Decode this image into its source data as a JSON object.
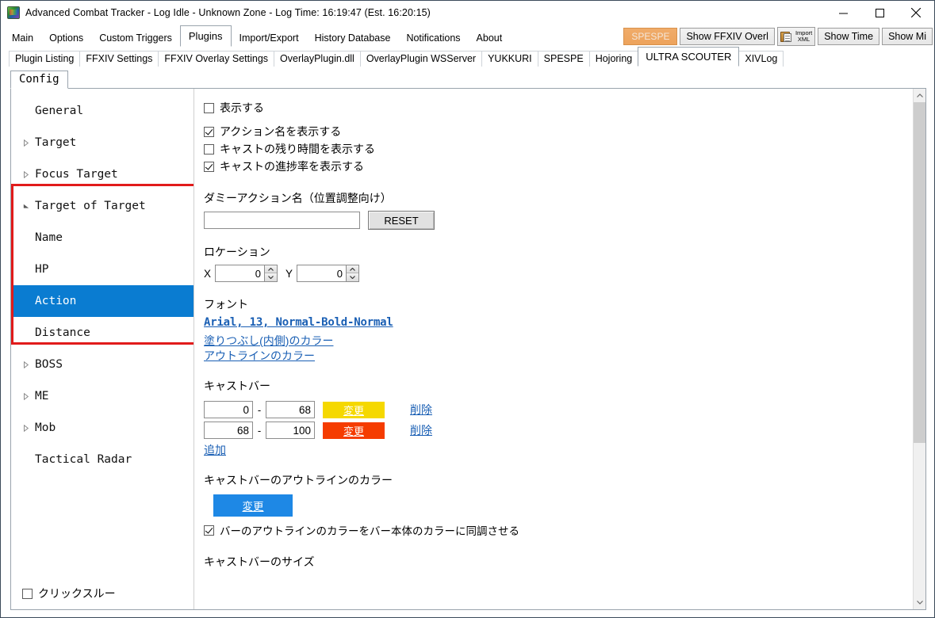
{
  "window": {
    "title": "Advanced Combat Tracker - Log Idle - Unknown Zone - Log Time: 16:19:47 (Est. 16:20:15)",
    "app_icon": "act-app-icon",
    "minimize": "minimize-icon",
    "maximize": "maximize-icon",
    "close": "close-icon"
  },
  "main_tabs": [
    {
      "label": "Main",
      "active": false
    },
    {
      "label": "Options",
      "active": false
    },
    {
      "label": "Custom Triggers",
      "active": false
    },
    {
      "label": "Plugins",
      "active": true
    },
    {
      "label": "Import/Export",
      "active": false
    },
    {
      "label": "History Database",
      "active": false
    },
    {
      "label": "Notifications",
      "active": false
    },
    {
      "label": "About",
      "active": false
    }
  ],
  "toolbar": {
    "spespe_label": "SPESPE",
    "spespe_color": "#eda35c",
    "show_overlay_label": "Show FFXIV Overl",
    "import_xml_line1": "Import",
    "import_xml_line2": "XML",
    "show_time_label": "Show Time",
    "show_mi_label": "Show Mi"
  },
  "plugin_tabs": [
    {
      "label": "Plugin Listing",
      "active": false
    },
    {
      "label": "FFXIV Settings",
      "active": false
    },
    {
      "label": "FFXIV Overlay Settings",
      "active": false
    },
    {
      "label": "OverlayPlugin.dll",
      "active": false
    },
    {
      "label": "OverlayPlugin WSServer",
      "active": false
    },
    {
      "label": "YUKKURI",
      "active": false
    },
    {
      "label": "SPESPE",
      "active": false
    },
    {
      "label": "Hojoring",
      "active": false
    },
    {
      "label": "ULTRA SCOUTER",
      "active": true
    },
    {
      "label": "XIVLog",
      "active": false
    }
  ],
  "config_tab": {
    "label": "Config"
  },
  "tree": {
    "items": [
      {
        "label": "General",
        "depth": 0,
        "expander": "none",
        "selected": false
      },
      {
        "label": "Target",
        "depth": 0,
        "expander": "collapsed",
        "selected": false
      },
      {
        "label": "Focus Target",
        "depth": 0,
        "expander": "collapsed",
        "selected": false
      },
      {
        "label": "Target of Target",
        "depth": 0,
        "expander": "expanded",
        "selected": false
      },
      {
        "label": "Name",
        "depth": 1,
        "expander": "none",
        "selected": false
      },
      {
        "label": "HP",
        "depth": 1,
        "expander": "none",
        "selected": false
      },
      {
        "label": "Action",
        "depth": 1,
        "expander": "none",
        "selected": true
      },
      {
        "label": "Distance",
        "depth": 1,
        "expander": "none",
        "selected": false
      },
      {
        "label": "BOSS",
        "depth": 0,
        "expander": "collapsed",
        "selected": false
      },
      {
        "label": "ME",
        "depth": 0,
        "expander": "collapsed",
        "selected": false
      },
      {
        "label": "Mob",
        "depth": 0,
        "expander": "collapsed",
        "selected": false
      },
      {
        "label": "Tactical Radar",
        "depth": 0,
        "expander": "none",
        "selected": false
      }
    ],
    "highlight_color": "#e11b1b",
    "selected_color": "#0a7cd1",
    "clickthrough": {
      "label": "クリックスルー",
      "checked": false
    }
  },
  "content": {
    "checkboxes": [
      {
        "label": "表示する",
        "checked": false
      },
      {
        "label": "アクション名を表示する",
        "checked": true
      },
      {
        "label": "キャストの残り時間を表示する",
        "checked": false
      },
      {
        "label": "キャストの進捗率を表示する",
        "checked": true
      }
    ],
    "dummy_action": {
      "label": "ダミーアクション名（位置調整向け）",
      "value": "",
      "placeholder": "",
      "reset_label": "RESET"
    },
    "location": {
      "label": "ロケーション",
      "x_label": "X",
      "x_value": "0",
      "y_label": "Y",
      "y_value": "0"
    },
    "font": {
      "label": "フォント",
      "value": "Arial, 13, Normal-Bold-Normal",
      "fill_color_link": "塗りつぶし(内側)のカラー",
      "outline_color_link": "アウトラインのカラー"
    },
    "castbar": {
      "label": "キャストバー",
      "rows": [
        {
          "from": "0",
          "to": "68",
          "button_label": "変更",
          "button_color": "#f5d800",
          "delete_label": "削除"
        },
        {
          "from": "68",
          "to": "100",
          "button_label": "変更",
          "button_color": "#f53c00",
          "delete_label": "削除"
        }
      ],
      "add_label": "追加"
    },
    "castbar_outline": {
      "label": "キャストバーのアウトラインのカラー",
      "button_label": "変更",
      "button_color": "#1e88e5",
      "sync_checkbox": {
        "label": "バーのアウトラインのカラーをバー本体のカラーに同調させる",
        "checked": true
      }
    },
    "castbar_size": {
      "label": "キャストバーのサイズ"
    }
  },
  "scrollbar": {
    "up": "scroll-up-icon",
    "down": "scroll-down-icon",
    "thumb_top_pct": 0,
    "thumb_height_pct": 69
  }
}
